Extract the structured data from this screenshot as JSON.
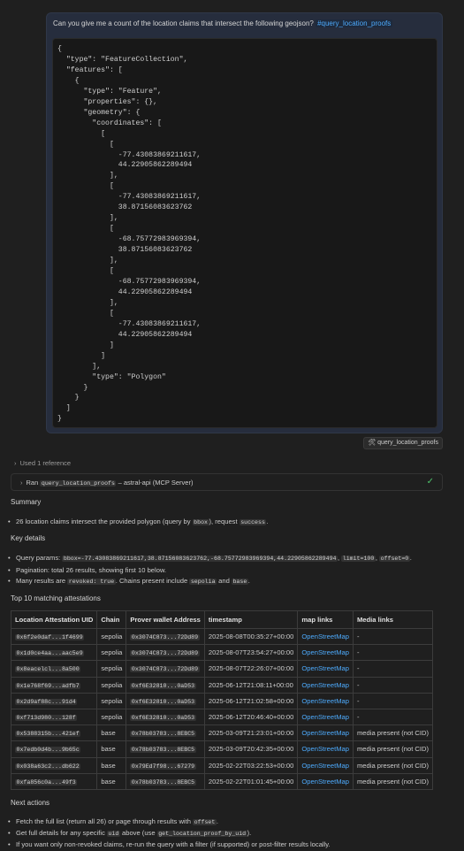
{
  "user_message": {
    "text": "Can you give me a count of the location claims that intersect the following geojson?",
    "reference": "#query_location_proofs",
    "geojson": "{\n  \"type\": \"FeatureCollection\",\n  \"features\": [\n    {\n      \"type\": \"Feature\",\n      \"properties\": {},\n      \"geometry\": {\n        \"coordinates\": [\n          [\n            [\n              -77.43083869211617,\n              44.22905862289494\n            ],\n            [\n              -77.43083869211617,\n              38.87156083623762\n            ],\n            [\n              -68.75772983969394,\n              38.87156083623762\n            ],\n            [\n              -68.75772983969394,\n              44.22905862289494\n            ],\n            [\n              -77.43083869211617,\n              44.22905862289494\n            ]\n          ]\n        ],\n        \"type\": \"Polygon\"\n      }\n    }\n  ]\n}"
  },
  "tool_pill": "query_location_proofs",
  "used_reference": "Used 1 reference",
  "ran": {
    "prefix": "Ran",
    "tool": "query_location_proofs",
    "suffix": "– astral-api (MCP Server)"
  },
  "summary": {
    "title": "Summary",
    "b1_a": "26 location claims intersect the provided polygon (query by",
    "b1_code1": "bbox",
    "b1_b": "), request",
    "b1_code2": "success",
    "b1_c": "."
  },
  "key_details": {
    "title": "Key details",
    "params_label": "Query params:",
    "params_code1": "bbox=-77.43083869211617,38.87156083623762,-68.75772983969394,44.22905862289494",
    "params_code2": "limit=100",
    "params_code3": "offset=0",
    "pagination": "Pagination: total 26 results, showing first 10 below.",
    "revoked_a": "Many results are",
    "revoked_code": "revoked: true",
    "revoked_b": ". Chains present include",
    "chain1": "sepolia",
    "and": "and",
    "chain2": "base",
    "end": "."
  },
  "table": {
    "title": "Top 10 matching attestations",
    "headers": [
      "Location Attestation UID",
      "Chain",
      "Prover wallet Address",
      "timestamp",
      "map links",
      "Media links"
    ],
    "rows": [
      [
        "0x6f2e0daf...1f4699",
        "sepolia",
        "0x3074C873...72Dd89",
        "2025-08-08T00:35:27+00:00",
        "OpenStreetMap",
        "-"
      ],
      [
        "0x1d0ce4aa...aac5e9",
        "sepolia",
        "0x3074C873...72Dd89",
        "2025-08-07T23:54:27+00:00",
        "OpenStreetMap",
        "-"
      ],
      [
        "0x8eacelcl...8a500",
        "sepolia",
        "0x3074C873...72Dd89",
        "2025-08-07T22:26:07+00:00",
        "OpenStreetMap",
        "-"
      ],
      [
        "0x1e768f69...adfb7",
        "sepolia",
        "0xf6E32810...0aD53",
        "2025-06-12T21:08:11+00:00",
        "OpenStreetMap",
        "-"
      ],
      [
        "0x2d9af88c...91d4",
        "sepolia",
        "0xf6E32810...0aD53",
        "2025-06-12T21:02:58+00:00",
        "OpenStreetMap",
        "-"
      ],
      [
        "0xf713d980...128f",
        "sepolia",
        "0xf6E32810...0aD53",
        "2025-06-12T20:46:40+00:00",
        "OpenStreetMap",
        "-"
      ],
      [
        "0x5388315b...421ef",
        "base",
        "0x78b03783...8EBC5",
        "2025-03-09T21:23:01+00:00",
        "OpenStreetMap",
        "media present (not CID)"
      ],
      [
        "0x7edb0d4b...9b65c",
        "base",
        "0x78b03783...8EBC5",
        "2025-03-09T20:42:35+00:00",
        "OpenStreetMap",
        "media present (not CID)"
      ],
      [
        "0x038a63c2...db622",
        "base",
        "0x79Ed7f98...67279",
        "2025-02-22T03:22:53+00:00",
        "OpenStreetMap",
        "media present (not CID)"
      ],
      [
        "0xfa856c0a...49f3",
        "base",
        "0x78b03783...8EBC5",
        "2025-02-22T01:01:45+00:00",
        "OpenStreetMap",
        "media present (not CID)"
      ]
    ]
  },
  "next_actions": {
    "title": "Next actions",
    "b1_a": "Fetch the full list (return all 26) or page through results with",
    "b1_code": "offset",
    "b1_b": ".",
    "b2_a": "Get full details for any specific",
    "b2_code1": "uid",
    "b2_b": "above (use",
    "b2_code2": "get_location_proof_by_uid",
    "b2_c": ").",
    "b3": "If you want only non-revoked claims, re-run the query with a filter (if supported) or post-filter results locally."
  },
  "colors": {
    "link": "#4daafc",
    "success_check": "#4ec36b",
    "user_bubble": "#262d3d"
  }
}
